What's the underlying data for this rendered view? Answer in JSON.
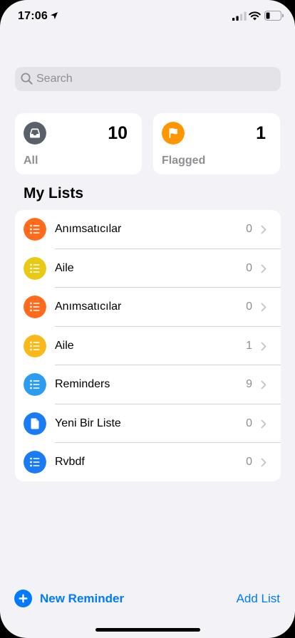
{
  "status_bar": {
    "time": "17:06",
    "icons": [
      "location-arrow-icon",
      "cellular-signal-icon",
      "wifi-icon",
      "battery-icon"
    ]
  },
  "search": {
    "placeholder": "Search",
    "value": ""
  },
  "smart_lists": [
    {
      "label": "All",
      "count": "10",
      "icon": "tray-icon",
      "color": "#5a6069"
    },
    {
      "label": "Flagged",
      "count": "1",
      "icon": "flag-icon",
      "color": "#ff9500"
    }
  ],
  "my_lists_title": "My Lists",
  "lists": [
    {
      "name": "Anımsatıcılar",
      "count": "0",
      "icon": "list-bullet-icon",
      "color": "#ff6b1a"
    },
    {
      "name": "Aile",
      "count": "0",
      "icon": "list-bullet-icon",
      "color": "#e8c913"
    },
    {
      "name": "Anımsatıcılar",
      "count": "0",
      "icon": "list-bullet-icon",
      "color": "#ff6b1a"
    },
    {
      "name": "Aile",
      "count": "1",
      "icon": "list-bullet-icon",
      "color": "#f9b91a"
    },
    {
      "name": "Reminders",
      "count": "9",
      "icon": "list-bullet-icon",
      "color": "#2c9cf0"
    },
    {
      "name": "Yeni Bir Liste",
      "count": "0",
      "icon": "document-icon",
      "color": "#1a7cf5"
    },
    {
      "name": "Rvbdf",
      "count": "0",
      "icon": "list-bullet-icon",
      "color": "#1a7cf5"
    }
  ],
  "toolbar": {
    "new_reminder_label": "New Reminder",
    "add_list_label": "Add List",
    "accent_color": "#007aff"
  }
}
